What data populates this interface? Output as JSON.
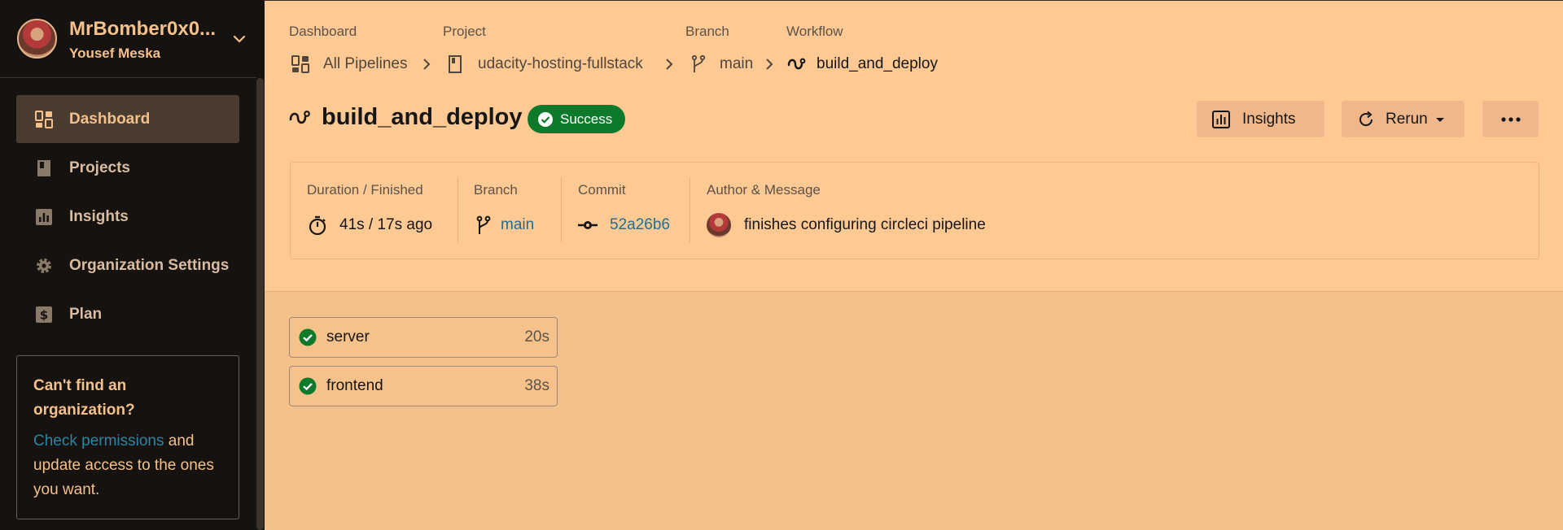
{
  "user": {
    "name": "MrBomber0x0...",
    "subtitle": "Yousef Meska"
  },
  "nav": {
    "items": [
      {
        "label": "Dashboard",
        "icon": "dashboard-icon",
        "active": true
      },
      {
        "label": "Projects",
        "icon": "projects-icon"
      },
      {
        "label": "Insights",
        "icon": "insights-icon"
      },
      {
        "label": "Organization Settings",
        "icon": "gear-icon"
      },
      {
        "label": "Plan",
        "icon": "dollar-icon"
      }
    ]
  },
  "help": {
    "title": "Can't find an organization?",
    "link": "Check permissions",
    "text": "and update access to the ones you want."
  },
  "breadcrumb": {
    "dashboard": {
      "header": "Dashboard",
      "label": "All Pipelines"
    },
    "project": {
      "header": "Project",
      "label": "udacity-hosting-fullstack"
    },
    "branch": {
      "header": "Branch",
      "label": "main"
    },
    "workflow": {
      "header": "Workflow",
      "label": "build_and_deploy"
    }
  },
  "workflow": {
    "title": "build_and_deploy",
    "status": "Success",
    "actions": {
      "insights": "Insights",
      "rerun": "Rerun"
    }
  },
  "info": {
    "duration": {
      "label": "Duration / Finished",
      "value": "41s / 17s ago"
    },
    "branch": {
      "label": "Branch",
      "value": "main"
    },
    "commit": {
      "label": "Commit",
      "value": "52a26b6"
    },
    "author": {
      "label": "Author & Message",
      "message": "finishes configuring circleci pipeline"
    }
  },
  "jobs": [
    {
      "name": "server",
      "duration": "20s",
      "status": "success"
    },
    {
      "name": "frontend",
      "duration": "38s",
      "status": "success"
    }
  ],
  "colors": {
    "sidebar_bg": "#161210",
    "accent": "#f5c18b",
    "success": "#0d7a2b",
    "link": "#1c6f95"
  }
}
